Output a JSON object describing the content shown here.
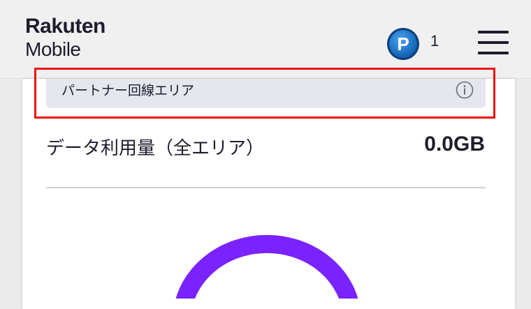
{
  "header": {
    "logo_line1": "Rakuten",
    "logo_line2": "Mobile",
    "points_badge_letter": "P",
    "points_count": "1",
    "points_icon": "rakuten-points-icon",
    "menu_icon": "hamburger-menu-icon"
  },
  "area_selector": {
    "label": "パートナー回線エリア",
    "info_icon": "info-icon"
  },
  "usage": {
    "label": "データ利用量（全エリア）",
    "value": "0.0GB"
  },
  "colors": {
    "accent_purple": "#7a22ff",
    "highlight_red": "#ee1111",
    "points_blue": "#1e73c8",
    "text_dark": "#1d1d2b"
  }
}
